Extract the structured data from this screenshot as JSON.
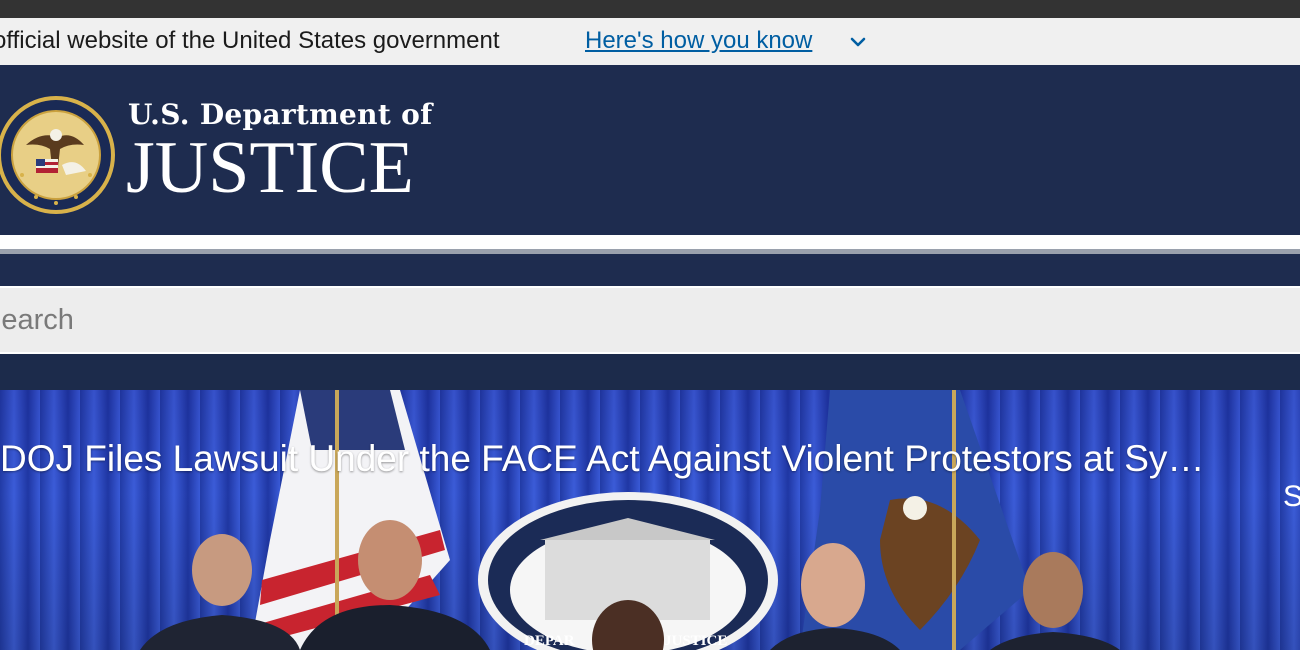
{
  "gov_banner": {
    "official_text": "official website of the United States government",
    "how_link": "Here's how you know",
    "chevron_icon": "chevron-down-icon"
  },
  "header": {
    "seal_icon": "doj-seal",
    "brand_top": "U.S. Department of",
    "brand_main": "JUSTICE"
  },
  "search": {
    "placeholder": "Search"
  },
  "hero": {
    "title": "DOJ Files Lawsuit Under the FACE Act Against Violent Protestors at Sy…",
    "next_title_fragment": "S",
    "podium_text": "DEPARTMENT OF JUSTICE"
  },
  "colors": {
    "header_bg": "#1e2c4f",
    "link": "#005ea2",
    "banner_bg": "#f0f0f0",
    "hero_blue": "#2f52d6"
  }
}
